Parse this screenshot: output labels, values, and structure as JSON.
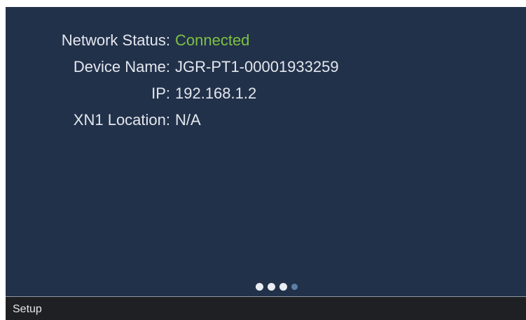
{
  "info": {
    "network_status": {
      "label": "Network Status:",
      "value": "Connected"
    },
    "device_name": {
      "label": "Device Name:",
      "value": "JGR-PT1-00001933259"
    },
    "ip": {
      "label": "IP:",
      "value": "192.168.1.2"
    },
    "xn1_location": {
      "label": "XN1 Location:",
      "value": "N/A"
    }
  },
  "pager": {
    "total_pages": 4,
    "current_page": 3
  },
  "bottom_bar": {
    "label": "Setup"
  },
  "colors": {
    "background": "#22314a",
    "status_connected": "#7cc242",
    "bottom_bar": "#1f2023"
  }
}
